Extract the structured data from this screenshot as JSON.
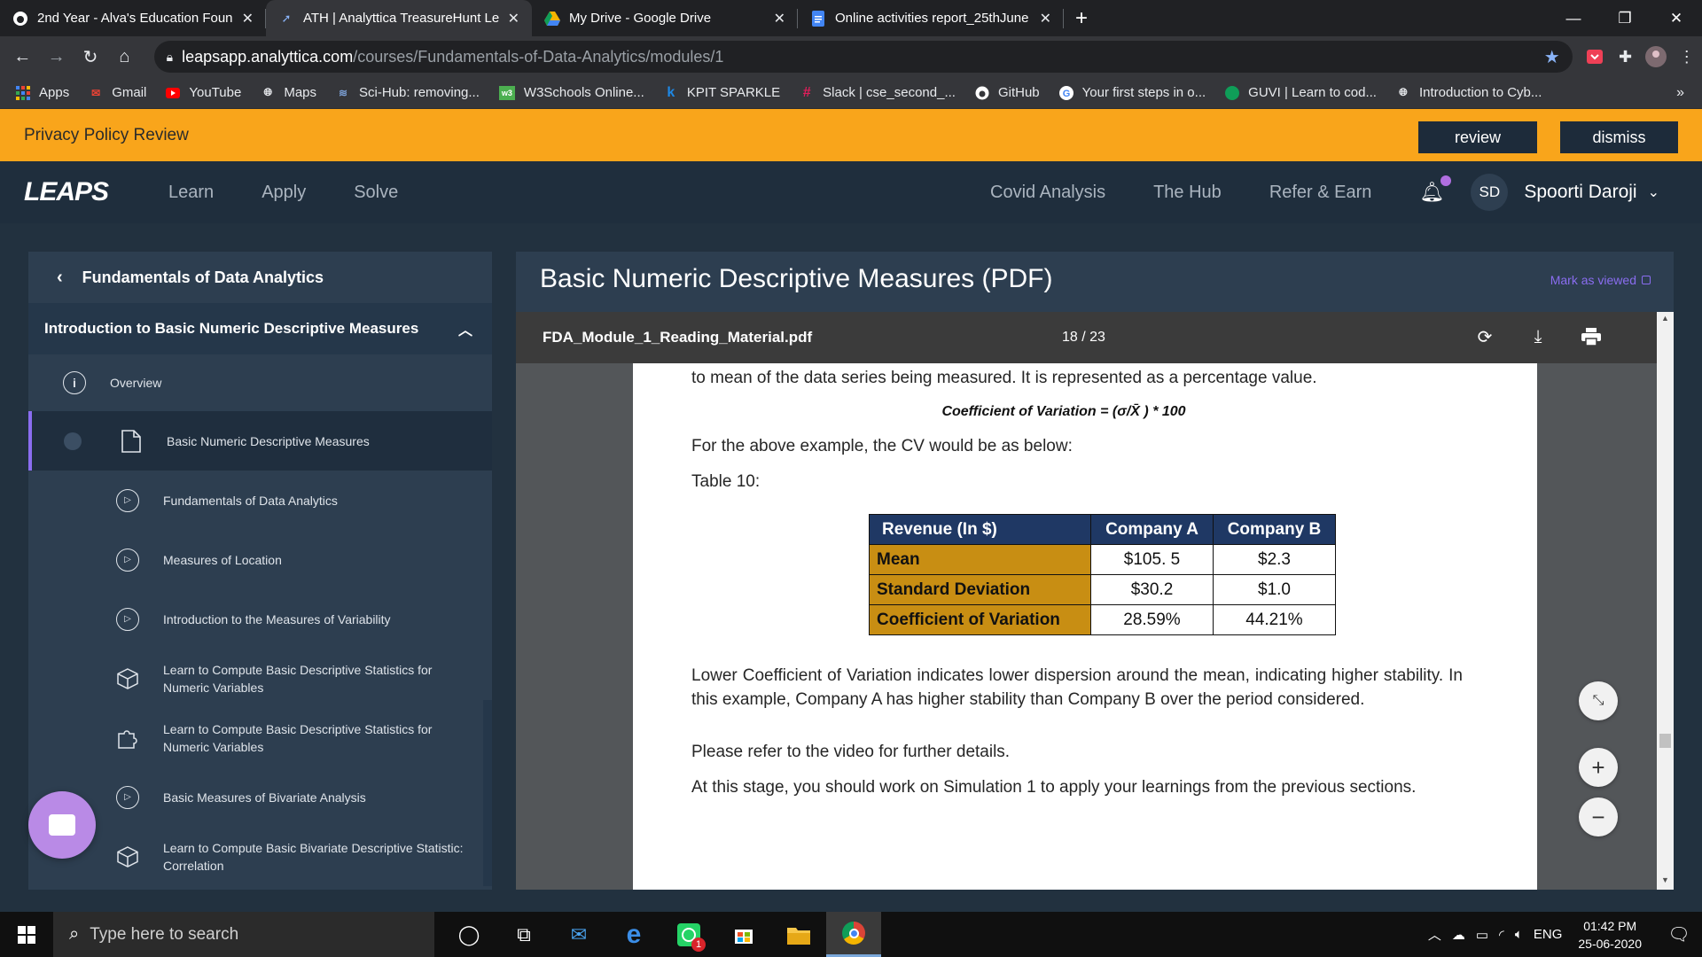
{
  "browser": {
    "tabs": [
      {
        "title": "2nd Year - Alva's Education Foun",
        "icon": "github-icon",
        "active": false
      },
      {
        "title": "ATH | Analyttica TreasureHunt Le",
        "icon": "analyttica-icon",
        "active": true
      },
      {
        "title": "My Drive - Google Drive",
        "icon": "drive-icon",
        "active": false
      },
      {
        "title": "Online activities report_25thJune",
        "icon": "docs-icon",
        "active": false
      }
    ],
    "url_host": "leapsapp.analyttica.com",
    "url_path": "/courses/Fundamentals-of-Data-Analytics/modules/1",
    "bookmarks": [
      {
        "label": "Apps",
        "icon": "apps-grid-icon",
        "color": "#4285f4"
      },
      {
        "label": "Gmail",
        "icon": "gmail-icon",
        "color": "#ea4335"
      },
      {
        "label": "YouTube",
        "icon": "youtube-icon",
        "color": "#ff0000"
      },
      {
        "label": "Maps",
        "icon": "globe-icon",
        "color": "#e8eaed"
      },
      {
        "label": "Sci-Hub: removing...",
        "icon": "scihub-icon",
        "color": "#7b9fd4"
      },
      {
        "label": "W3Schools Online...",
        "icon": "w3schools-icon",
        "color": "#4caf50"
      },
      {
        "label": "KPIT SPARKLE",
        "icon": "kpit-icon",
        "color": "#1e88e5"
      },
      {
        "label": "Slack | cse_second_...",
        "icon": "slack-icon",
        "color": "#e01e5a"
      },
      {
        "label": "GitHub",
        "icon": "github-icon",
        "color": "#ffffff"
      },
      {
        "label": "Your first steps in o...",
        "icon": "google-icon",
        "color": "#4285f4"
      },
      {
        "label": "GUVI | Learn to cod...",
        "icon": "guvi-icon",
        "color": "#0f9d58"
      },
      {
        "label": "Introduction to Cyb...",
        "icon": "globe-icon",
        "color": "#e8eaed"
      }
    ]
  },
  "banner": {
    "text": "Privacy Policy Review",
    "review_label": "review",
    "dismiss_label": "dismiss",
    "color": "#f9a51b"
  },
  "header": {
    "logo": "LEAPS",
    "nav_left": [
      "Learn",
      "Apply",
      "Solve"
    ],
    "nav_right": [
      "Covid Analysis",
      "The Hub",
      "Refer & Earn"
    ],
    "initials": "SD",
    "user_name": "Spoorti Daroji"
  },
  "sidebar": {
    "course_title": "Fundamentals of Data Analytics",
    "section_title": "Introduction to Basic Numeric Descriptive Measures",
    "overview_label": "Overview",
    "items": [
      {
        "label": "Basic Numeric Descriptive Measures",
        "icon": "document-icon",
        "active": true
      },
      {
        "label": "Fundamentals of Data Analytics",
        "icon": "play-icon",
        "active": false
      },
      {
        "label": "Measures of Location",
        "icon": "play-icon",
        "active": false
      },
      {
        "label": "Introduction to the Measures of Variability",
        "icon": "play-icon",
        "active": false
      },
      {
        "label": "Learn to Compute Basic Descriptive Statistics for Numeric Variables",
        "icon": "cube-icon",
        "active": false
      },
      {
        "label": "Learn to Compute Basic Descriptive Statistics for Numeric Variables",
        "icon": "puzzle-icon",
        "active": false
      },
      {
        "label": "Basic Measures of Bivariate Analysis",
        "icon": "play-icon",
        "active": false
      },
      {
        "label": "Learn to Compute Basic Bivariate Descriptive Statistic: Correlation",
        "icon": "cube-icon",
        "active": false
      }
    ]
  },
  "main": {
    "title": "Basic Numeric Descriptive Measures (PDF)",
    "mark_viewed": "Mark as viewed",
    "pdf_name": "FDA_Module_1_Reading_Material.pdf",
    "page_indicator": "18 / 23",
    "content": {
      "line1": "to mean of the data series being measured. It is represented as a percentage value.",
      "formula": "Coefficient of Variation = (σ/X̄ ) * 100",
      "line2": "For the above example, the CV would be as below:",
      "table_caption": "Table 10:",
      "table_headers": [
        "Revenue (In $)",
        "Company A",
        "Company B"
      ],
      "table_rows": [
        [
          "Mean",
          "$105. 5",
          "$2.3"
        ],
        [
          "Standard Deviation",
          "$30.2",
          "$1.0"
        ],
        [
          "Coefficient of Variation",
          "28.59%",
          "44.21%"
        ]
      ],
      "para1": "Lower Coefficient of Variation indicates lower dispersion around the mean, indicating higher stability. In this example, Company A has higher stability than Company B over the period considered.",
      "para2": "Please refer to the video for further details.",
      "para3": "At this stage, you should work on Simulation 1 to apply your learnings from the previous sections."
    }
  },
  "taskbar": {
    "search_placeholder": "Type here to search",
    "language": "ENG",
    "time": "01:42 PM",
    "date": "25-06-2020",
    "whatsapp_badge": "1"
  }
}
